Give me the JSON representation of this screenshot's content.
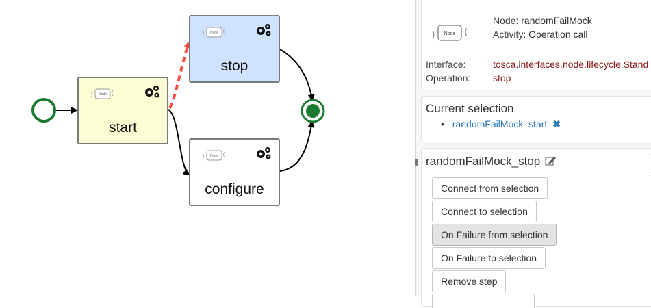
{
  "canvas": {
    "nodes": {
      "start": {
        "label": "start",
        "mini_label": "Node"
      },
      "stop": {
        "label": "stop",
        "mini_label": "Node"
      },
      "configure": {
        "label": "configure",
        "mini_label": "Node"
      }
    },
    "colors": {
      "start_fill": "#fdfdd3",
      "stop_fill": "#cfe2ff",
      "configure_fill": "#ffffff",
      "event_green": "#1a7a32",
      "failure_edge": "#f2513f"
    }
  },
  "details": {
    "node_key": "Node:",
    "node_value": "randomFailMock",
    "activity_key": "Activity:",
    "activity_value": "Operation call",
    "interface_key": "Interface:",
    "interface_value": "tosca.interfaces.node.lifecycle.Stand",
    "operation_key": "Operation:",
    "operation_value": "stop"
  },
  "selection": {
    "title": "Current selection",
    "items": [
      "randomFailMock_start"
    ]
  },
  "step": {
    "title": "randomFailMock_stop",
    "buttons": [
      "Connect from selection",
      "Connect to selection",
      "On Failure from selection",
      "On Failure to selection",
      "Remove step"
    ]
  }
}
